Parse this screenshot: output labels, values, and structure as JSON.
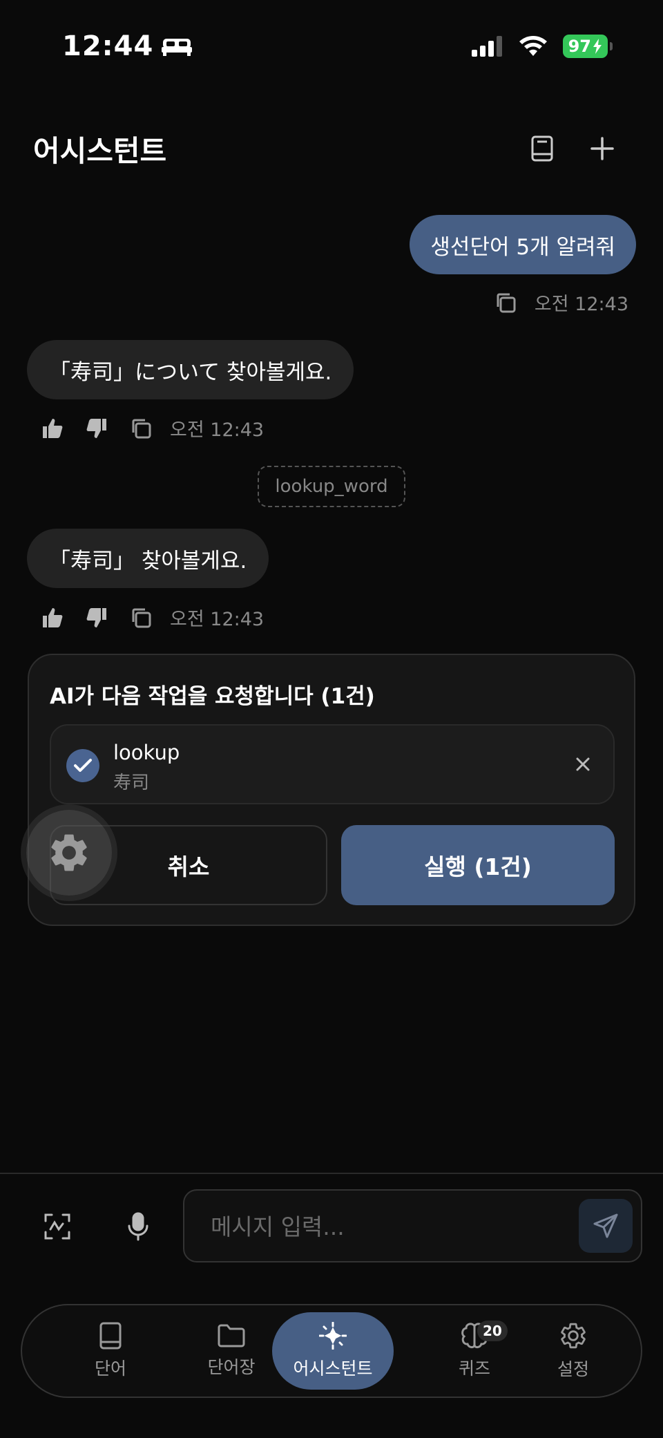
{
  "status": {
    "time": "12:44",
    "battery": "97"
  },
  "header": {
    "title": "어시스턴트"
  },
  "messages": {
    "user1": {
      "text": "생선단어 5개 알려줘",
      "time": "오전 12:43"
    },
    "ai1": {
      "text": "「寿司」について 찾아볼게요.",
      "time": "오전 12:43"
    },
    "tool": {
      "name": "lookup_word"
    },
    "ai2": {
      "text": "「寿司」 찾아볼게요.",
      "time": "오전 12:43"
    }
  },
  "approval": {
    "title": "AI가 다음 작업을 요청합니다 (1건)",
    "task_name": "lookup",
    "task_arg": "寿司",
    "cancel_label": "취소",
    "run_label": "실행 (1건)"
  },
  "input": {
    "placeholder": "메시지 입력..."
  },
  "nav": {
    "items": [
      {
        "label": "단어",
        "icon": "book-icon"
      },
      {
        "label": "단어장",
        "icon": "folder-icon"
      },
      {
        "label": "어시스턴트",
        "icon": "sparkle-icon",
        "active": true
      },
      {
        "label": "퀴즈",
        "icon": "brain-icon",
        "badge": "20"
      },
      {
        "label": "설정",
        "icon": "gear-icon"
      }
    ]
  },
  "colors": {
    "accent": "#475f85",
    "background": "#0a0a0a",
    "bubble_ai": "#232323",
    "battery": "#34c759"
  }
}
